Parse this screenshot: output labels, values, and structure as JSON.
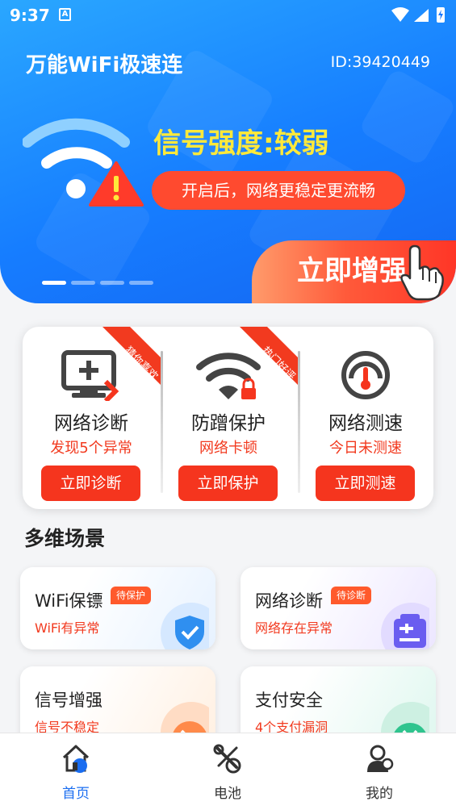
{
  "status_bar": {
    "time": "9:37",
    "notification_letter": "A"
  },
  "header": {
    "app_title": "万能WiFi极速连",
    "user_id": "ID:39420449",
    "signal_title": "信号强度:较弱",
    "signal_hint": "开启后，网络更稳定更流畅",
    "boost_label": "立即增强",
    "carousel": {
      "count": 4,
      "active_index": 0
    }
  },
  "features": [
    {
      "icon": "monitor-plus-icon",
      "ribbon": "猜你喜欢",
      "title": "网络诊断",
      "subtitle": "发现5个异常",
      "button": "立即诊断"
    },
    {
      "icon": "wifi-lock-icon",
      "ribbon": "热门好评",
      "title": "防蹭保护",
      "subtitle": "网络卡顿",
      "button": "立即保护"
    },
    {
      "icon": "speedometer-icon",
      "ribbon": "",
      "title": "网络测速",
      "subtitle": "今日未测速",
      "button": "立即测速"
    }
  ],
  "section_title": "多维场景",
  "scenes": [
    {
      "icon": "shield-check-icon",
      "title": "WiFi保镖",
      "badge": "待保护",
      "subtitle": "WiFi有异常"
    },
    {
      "icon": "clipboard-icon",
      "title": "网络诊断",
      "badge": "待诊断",
      "subtitle": "网络存在异常"
    },
    {
      "icon": "satellite-dish-icon",
      "title": "信号增强",
      "badge": "",
      "subtitle": "信号不稳定"
    },
    {
      "icon": "yuan-coin-icon",
      "title": "支付安全",
      "badge": "",
      "subtitle": "4个支付漏洞"
    }
  ],
  "tabbar": [
    {
      "icon": "home-icon",
      "label": "首页",
      "active": true
    },
    {
      "icon": "battery-tools-icon",
      "label": "电池",
      "active": false
    },
    {
      "icon": "profile-icon",
      "label": "我的",
      "active": false
    }
  ],
  "colors": {
    "brand_blue": "#1677ff",
    "accent_red": "#f5351e",
    "highlight_yellow": "#ffe93a",
    "active_tab": "#1a6df0"
  }
}
